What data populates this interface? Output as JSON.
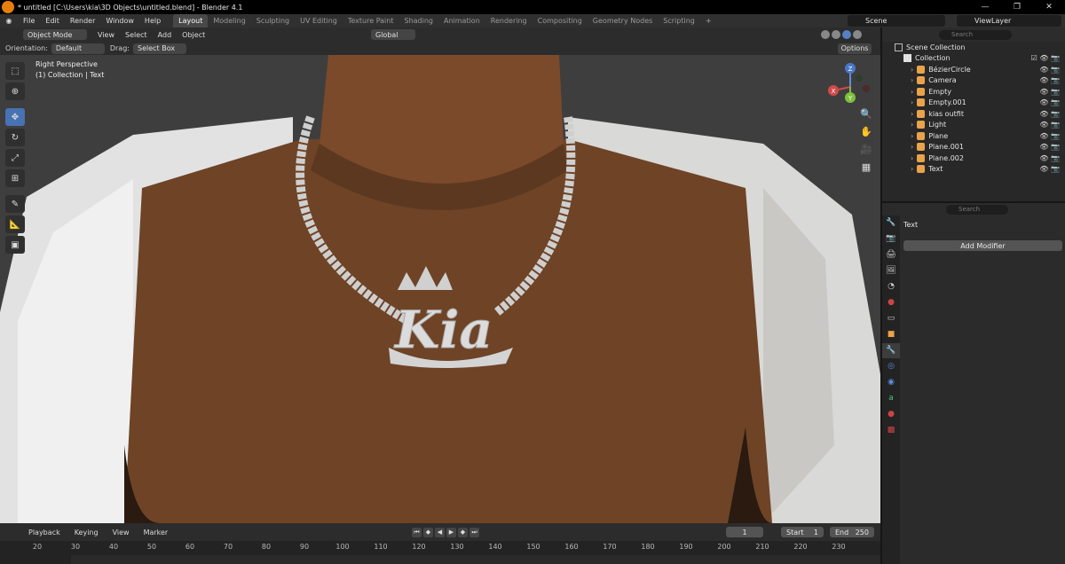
{
  "titlebar": {
    "title": "* untitled [C:\\Users\\kia\\3D Objects\\untitled.blend] - Blender 4.1",
    "minimize": "—",
    "maximize": "❐",
    "close": "✕"
  },
  "menu": [
    "File",
    "Edit",
    "Render",
    "Window",
    "Help"
  ],
  "workspaces": [
    "Layout",
    "Modeling",
    "Sculpting",
    "UV Editing",
    "Texture Paint",
    "Shading",
    "Animation",
    "Rendering",
    "Compositing",
    "Geometry Nodes",
    "Scripting"
  ],
  "workspace_add": "+",
  "scene": {
    "label": "Scene"
  },
  "view_layer": {
    "label": "ViewLayer"
  },
  "viewport_header": {
    "mode": "Object Mode",
    "menus": [
      "View",
      "Select",
      "Add",
      "Object"
    ],
    "transform_orientation": "Global"
  },
  "tool_header": {
    "orientation_label": "Orientation:",
    "orientation_value": "Default",
    "drag_label": "Drag:",
    "drag_value": "Select Box",
    "options": "Options"
  },
  "viewport": {
    "view_name": "Right Perspective",
    "collection_info": "(1) Collection | Text",
    "scene_text": "Kia",
    "gizmo_axes": [
      "Z",
      "X",
      "Y"
    ]
  },
  "timeline": {
    "menus": [
      "Playback",
      "Keying",
      "View",
      "Marker"
    ],
    "current_frame": "1",
    "start_label": "Start",
    "start_value": "1",
    "end_label": "End",
    "end_value": "250",
    "ruler_ticks": [
      "20",
      "30",
      "40",
      "50",
      "60",
      "70",
      "80",
      "90",
      "100",
      "110",
      "120",
      "130",
      "140",
      "150",
      "160",
      "170",
      "180",
      "190",
      "200",
      "210",
      "220",
      "230"
    ]
  },
  "outliner": {
    "search_placeholder": "Search",
    "scene_collection": "Scene Collection",
    "collection": "Collection",
    "items": [
      {
        "name": "BézierCircle",
        "icon": "curve-icon",
        "color": "#e8a34b"
      },
      {
        "name": "Camera",
        "icon": "camera-icon",
        "color": "#e8a34b"
      },
      {
        "name": "Empty",
        "icon": "empty-icon",
        "color": "#e8a34b"
      },
      {
        "name": "Empty.001",
        "icon": "empty-icon",
        "color": "#e8a34b"
      },
      {
        "name": "kias outfit",
        "icon": "mesh-icon",
        "color": "#e8a34b"
      },
      {
        "name": "Light",
        "icon": "light-icon",
        "color": "#e8a34b"
      },
      {
        "name": "Plane",
        "icon": "mesh-icon",
        "color": "#e8a34b"
      },
      {
        "name": "Plane.001",
        "icon": "mesh-icon",
        "color": "#e8a34b"
      },
      {
        "name": "Plane.002",
        "icon": "mesh-icon",
        "color": "#e8a34b"
      },
      {
        "name": "Text",
        "icon": "text-icon",
        "color": "#e8a34b"
      }
    ]
  },
  "properties": {
    "search_placeholder": "Search",
    "object_name": "Text",
    "add_modifier": "Add Modifier"
  },
  "colors": {
    "accent": "#4772b3",
    "selected_row": "#334d80",
    "object_orange": "#e8a34b",
    "data_green": "#4fc37a"
  }
}
